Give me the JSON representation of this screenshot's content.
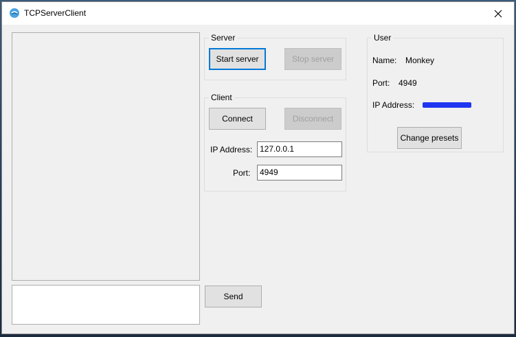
{
  "window": {
    "title": "TCPServerClient",
    "close_glyph": "✕"
  },
  "server": {
    "legend": "Server",
    "start_label": "Start server",
    "stop_label": "Stop server"
  },
  "client": {
    "legend": "Client",
    "connect_label": "Connect",
    "disconnect_label": "Disconnect",
    "ip_label": "IP Address:",
    "ip_value": "127.0.0.1",
    "port_label": "Port:",
    "port_value": "4949"
  },
  "user": {
    "legend": "User",
    "name_label": "Name:",
    "name_value": "Monkey",
    "port_label": "Port:",
    "port_value": "4949",
    "ip_label": "IP Address:",
    "ip_value_redacted": true,
    "change_presets_label": "Change presets"
  },
  "message": {
    "send_label": "Send",
    "input_value": ""
  },
  "colors": {
    "accent": "#0078d7",
    "redaction": "#1f35f0"
  }
}
